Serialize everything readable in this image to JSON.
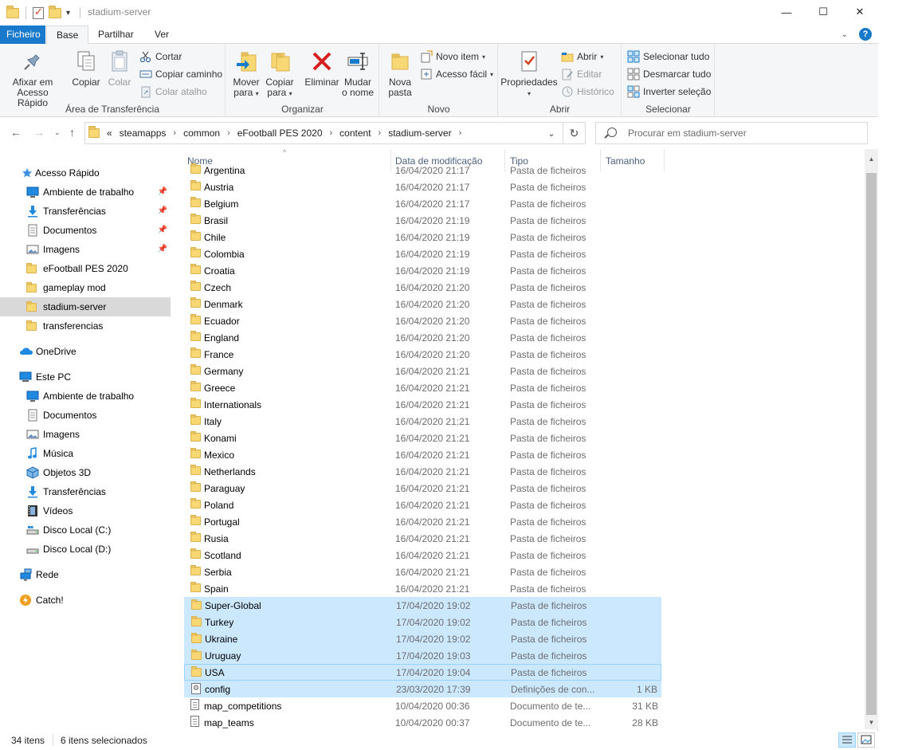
{
  "window": {
    "title": "stadium-server",
    "minimize": "—",
    "maximize": "☐",
    "close": "✕"
  },
  "ribbon_tabs": [
    {
      "label": "Ficheiro"
    },
    {
      "label": "Base"
    },
    {
      "label": "Partilhar"
    },
    {
      "label": "Ver"
    }
  ],
  "ribbon": {
    "clipboard": {
      "pin_label_1": "Afixar em",
      "pin_label_2": "Acesso Rápido",
      "copy": "Copiar",
      "paste": "Colar",
      "cut": "Cortar",
      "copy_path": "Copiar caminho",
      "paste_shortcut": "Colar atalho",
      "group_label": "Área de Transferência"
    },
    "organize": {
      "move_1": "Mover",
      "move_2": "para",
      "copy_1": "Copiar",
      "copy_2": "para",
      "delete": "Eliminar",
      "rename_1": "Mudar",
      "rename_2": "o nome",
      "group_label": "Organizar"
    },
    "new": {
      "new_folder_1": "Nova",
      "new_folder_2": "pasta",
      "new_item": "Novo item",
      "easy_access": "Acesso fácil",
      "group_label": "Novo"
    },
    "open": {
      "properties": "Propriedades",
      "open": "Abrir",
      "edit": "Editar",
      "history": "Histórico",
      "group_label": "Abrir"
    },
    "select": {
      "select_all": "Selecionar tudo",
      "select_none": "Desmarcar tudo",
      "invert": "Inverter seleção",
      "group_label": "Selecionar"
    }
  },
  "address": {
    "overflow": "«",
    "crumbs": [
      "steamapps",
      "common",
      "eFootball PES 2020",
      "content",
      "stadium-server"
    ],
    "search_placeholder": "Procurar em stadium-server"
  },
  "nav_pane": {
    "quick_access": "Acesso Rápido",
    "quick_items": [
      {
        "label": "Ambiente de trabalho",
        "icon": "desktop-icon"
      },
      {
        "label": "Transferências",
        "icon": "downloads-icon"
      },
      {
        "label": "Documentos",
        "icon": "documents-icon"
      },
      {
        "label": "Imagens",
        "icon": "pictures-icon"
      },
      {
        "label": "eFootball PES 2020",
        "icon": "folder-icon"
      },
      {
        "label": "gameplay mod",
        "icon": "folder-icon"
      },
      {
        "label": "stadium-server",
        "icon": "folder-icon"
      },
      {
        "label": "transferencias",
        "icon": "folder-icon"
      }
    ],
    "onedrive": "OneDrive",
    "this_pc": "Este PC",
    "pc_items": [
      {
        "label": "Ambiente de trabalho",
        "icon": "desktop-icon"
      },
      {
        "label": "Documentos",
        "icon": "documents-icon"
      },
      {
        "label": "Imagens",
        "icon": "pictures-icon"
      },
      {
        "label": "Música",
        "icon": "music-icon"
      },
      {
        "label": "Objetos 3D",
        "icon": "3d-objects-icon"
      },
      {
        "label": "Transferências",
        "icon": "downloads-icon"
      },
      {
        "label": "Vídeos",
        "icon": "videos-icon"
      },
      {
        "label": "Disco Local (C:)",
        "icon": "drive-icon"
      },
      {
        "label": "Disco Local (D:)",
        "icon": "drive-icon"
      }
    ],
    "network": "Rede",
    "catch": "Catch!"
  },
  "columns": {
    "name": "Nome",
    "date": "Data de modificação",
    "type": "Tipo",
    "size": "Tamanho"
  },
  "files": [
    {
      "name": "Argentina",
      "date": "16/04/2020 21:17",
      "type": "Pasta de ficheiros",
      "size": "",
      "kind": "folder",
      "selected": false
    },
    {
      "name": "Austria",
      "date": "16/04/2020 21:17",
      "type": "Pasta de ficheiros",
      "size": "",
      "kind": "folder",
      "selected": false
    },
    {
      "name": "Belgium",
      "date": "16/04/2020 21:17",
      "type": "Pasta de ficheiros",
      "size": "",
      "kind": "folder",
      "selected": false
    },
    {
      "name": "Brasil",
      "date": "16/04/2020 21:19",
      "type": "Pasta de ficheiros",
      "size": "",
      "kind": "folder",
      "selected": false
    },
    {
      "name": "Chile",
      "date": "16/04/2020 21:19",
      "type": "Pasta de ficheiros",
      "size": "",
      "kind": "folder",
      "selected": false
    },
    {
      "name": "Colombia",
      "date": "16/04/2020 21:19",
      "type": "Pasta de ficheiros",
      "size": "",
      "kind": "folder",
      "selected": false
    },
    {
      "name": "Croatia",
      "date": "16/04/2020 21:19",
      "type": "Pasta de ficheiros",
      "size": "",
      "kind": "folder",
      "selected": false
    },
    {
      "name": "Czech",
      "date": "16/04/2020 21:20",
      "type": "Pasta de ficheiros",
      "size": "",
      "kind": "folder",
      "selected": false
    },
    {
      "name": "Denmark",
      "date": "16/04/2020 21:20",
      "type": "Pasta de ficheiros",
      "size": "",
      "kind": "folder",
      "selected": false
    },
    {
      "name": "Ecuador",
      "date": "16/04/2020 21:20",
      "type": "Pasta de ficheiros",
      "size": "",
      "kind": "folder",
      "selected": false
    },
    {
      "name": "England",
      "date": "16/04/2020 21:20",
      "type": "Pasta de ficheiros",
      "size": "",
      "kind": "folder",
      "selected": false
    },
    {
      "name": "France",
      "date": "16/04/2020 21:20",
      "type": "Pasta de ficheiros",
      "size": "",
      "kind": "folder",
      "selected": false
    },
    {
      "name": "Germany",
      "date": "16/04/2020 21:21",
      "type": "Pasta de ficheiros",
      "size": "",
      "kind": "folder",
      "selected": false
    },
    {
      "name": "Greece",
      "date": "16/04/2020 21:21",
      "type": "Pasta de ficheiros",
      "size": "",
      "kind": "folder",
      "selected": false
    },
    {
      "name": "Internationals",
      "date": "16/04/2020 21:21",
      "type": "Pasta de ficheiros",
      "size": "",
      "kind": "folder",
      "selected": false
    },
    {
      "name": "Italy",
      "date": "16/04/2020 21:21",
      "type": "Pasta de ficheiros",
      "size": "",
      "kind": "folder",
      "selected": false
    },
    {
      "name": "Konami",
      "date": "16/04/2020 21:21",
      "type": "Pasta de ficheiros",
      "size": "",
      "kind": "folder",
      "selected": false
    },
    {
      "name": "Mexico",
      "date": "16/04/2020 21:21",
      "type": "Pasta de ficheiros",
      "size": "",
      "kind": "folder",
      "selected": false
    },
    {
      "name": "Netherlands",
      "date": "16/04/2020 21:21",
      "type": "Pasta de ficheiros",
      "size": "",
      "kind": "folder",
      "selected": false
    },
    {
      "name": "Paraguay",
      "date": "16/04/2020 21:21",
      "type": "Pasta de ficheiros",
      "size": "",
      "kind": "folder",
      "selected": false
    },
    {
      "name": "Poland",
      "date": "16/04/2020 21:21",
      "type": "Pasta de ficheiros",
      "size": "",
      "kind": "folder",
      "selected": false
    },
    {
      "name": "Portugal",
      "date": "16/04/2020 21:21",
      "type": "Pasta de ficheiros",
      "size": "",
      "kind": "folder",
      "selected": false
    },
    {
      "name": "Rusia",
      "date": "16/04/2020 21:21",
      "type": "Pasta de ficheiros",
      "size": "",
      "kind": "folder",
      "selected": false
    },
    {
      "name": "Scotland",
      "date": "16/04/2020 21:21",
      "type": "Pasta de ficheiros",
      "size": "",
      "kind": "folder",
      "selected": false
    },
    {
      "name": "Serbia",
      "date": "16/04/2020 21:21",
      "type": "Pasta de ficheiros",
      "size": "",
      "kind": "folder",
      "selected": false
    },
    {
      "name": "Spain",
      "date": "16/04/2020 21:21",
      "type": "Pasta de ficheiros",
      "size": "",
      "kind": "folder",
      "selected": false
    },
    {
      "name": "Super-Global",
      "date": "17/04/2020 19:02",
      "type": "Pasta de ficheiros",
      "size": "",
      "kind": "folder",
      "selected": true
    },
    {
      "name": "Turkey",
      "date": "17/04/2020 19:02",
      "type": "Pasta de ficheiros",
      "size": "",
      "kind": "folder",
      "selected": true
    },
    {
      "name": "Ukraine",
      "date": "17/04/2020 19:02",
      "type": "Pasta de ficheiros",
      "size": "",
      "kind": "folder",
      "selected": true
    },
    {
      "name": "Uruguay",
      "date": "17/04/2020 19:03",
      "type": "Pasta de ficheiros",
      "size": "",
      "kind": "folder",
      "selected": true
    },
    {
      "name": "USA",
      "date": "17/04/2020 19:04",
      "type": "Pasta de ficheiros",
      "size": "",
      "kind": "folder",
      "selected": true,
      "focused": true
    },
    {
      "name": "config",
      "date": "23/03/2020 17:39",
      "type": "Definições de con...",
      "size": "1 KB",
      "kind": "config",
      "selected": true
    },
    {
      "name": "map_competitions",
      "date": "10/04/2020 00:36",
      "type": "Documento de te...",
      "size": "31 KB",
      "kind": "text",
      "selected": false
    },
    {
      "name": "map_teams",
      "date": "10/04/2020 00:37",
      "type": "Documento de te...",
      "size": "28 KB",
      "kind": "text",
      "selected": false
    }
  ],
  "status": {
    "item_count": "34 itens",
    "selected_count": "6 itens selecionados"
  },
  "colors": {
    "accent": "#1979ca",
    "selection": "#cce8ff",
    "selection_border": "#99d1ff",
    "folder": "#f8d775"
  }
}
